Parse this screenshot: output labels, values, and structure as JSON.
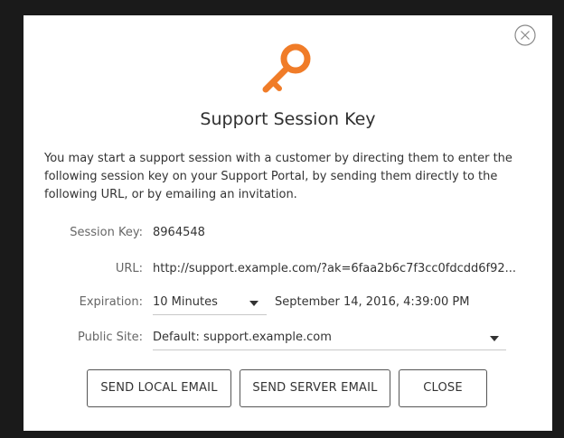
{
  "dialog": {
    "title": "Support Session Key",
    "description": "You may start a support session with a customer by directing them to enter the following session key on your Support Portal, by sending them directly to the following URL, or by emailing an invitation.",
    "close_icon": "close-circle-icon",
    "key_icon": "key-icon",
    "accent_color": "#f07c28"
  },
  "fields": {
    "session_key_label": "Session Key:",
    "session_key_value": "8964548",
    "url_label": "URL:",
    "url_value": "http://support.example.com/?ak=6faa2b6c7f3cc0fdcdd6f92...",
    "expiration_label": "Expiration:",
    "expiration_value": "10 Minutes",
    "expiration_datetime": "September 14, 2016, 4:39:00 PM",
    "public_site_label": "Public Site:",
    "public_site_value": "Default: support.example.com"
  },
  "buttons": {
    "send_local_email": "SEND LOCAL EMAIL",
    "send_server_email": "SEND SERVER EMAIL",
    "close": "CLOSE"
  }
}
